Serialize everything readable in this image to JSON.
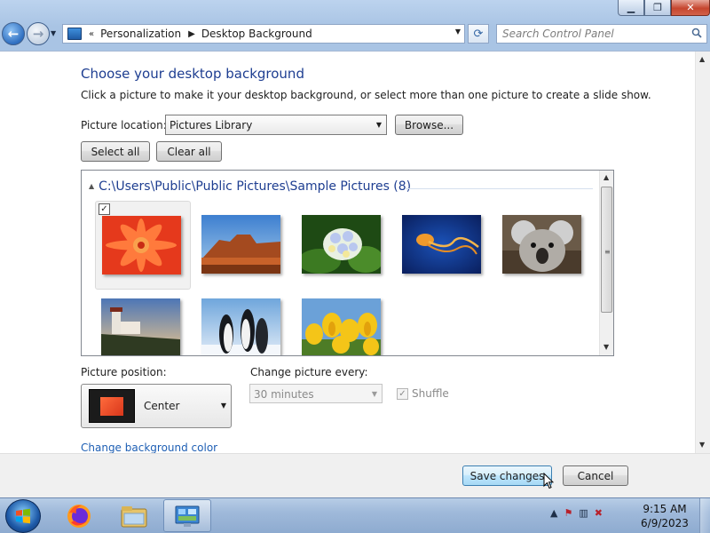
{
  "window": {
    "minimize_icon": "minimize-icon",
    "maximize_icon": "restore-icon",
    "close_icon": "close-icon"
  },
  "address": {
    "separator": "«",
    "crumbs": [
      "Personalization",
      "Desktop Background"
    ],
    "search_placeholder": "Search Control Panel"
  },
  "page": {
    "heading": "Choose your desktop background",
    "description": "Click a picture to make it your desktop background, or select more than one picture to create a slide show.",
    "location_label": "Picture location:",
    "location_value": "Pictures Library",
    "browse_label": "Browse...",
    "select_all_label": "Select all",
    "clear_all_label": "Clear all",
    "group_header": "C:\\Users\\Public\\Public Pictures\\Sample Pictures (8)",
    "pictures": [
      {
        "name": "chrysanthemum",
        "selected": true
      },
      {
        "name": "desert",
        "selected": false
      },
      {
        "name": "hydrangeas",
        "selected": false
      },
      {
        "name": "jellyfish",
        "selected": false
      },
      {
        "name": "koala",
        "selected": false
      },
      {
        "name": "lighthouse",
        "selected": false
      },
      {
        "name": "penguins",
        "selected": false
      },
      {
        "name": "tulips",
        "selected": false
      }
    ],
    "position_label": "Picture position:",
    "position_value": "Center",
    "change_every_label": "Change picture every:",
    "change_every_value": "30 minutes",
    "shuffle_label": "Shuffle",
    "shuffle_checked": true,
    "bgcolor_link": "Change background color"
  },
  "footer": {
    "save_label": "Save changes",
    "cancel_label": "Cancel"
  },
  "taskbar": {
    "time": "9:15 AM",
    "date": "6/9/2023",
    "apps": [
      "firefox",
      "windows-explorer",
      "control-panel"
    ]
  }
}
